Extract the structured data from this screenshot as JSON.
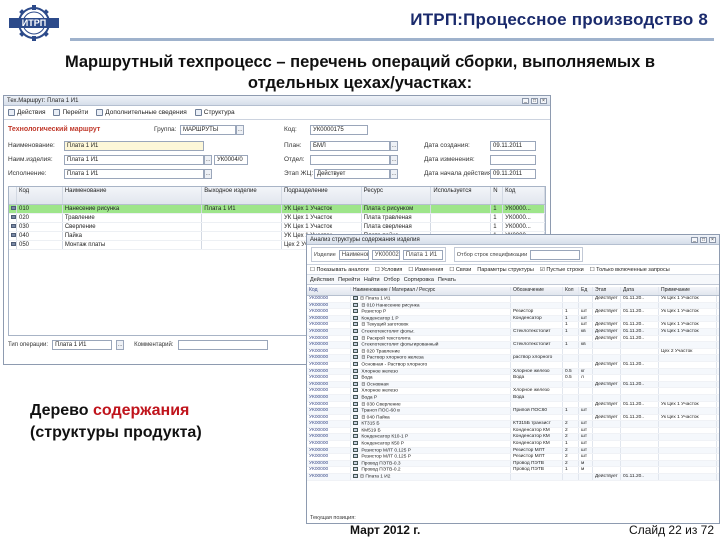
{
  "slide": {
    "title": "ИТРП:Процессное производство 8",
    "subtitle_line1": "Маршрутный техпроцесс – перечень операций сборки, выполняемых в",
    "subtitle_line2": "отдельных цехах/участках:",
    "caption_line1_prefix": "Дерево ",
    "caption_line1_red": "содержания",
    "caption_line2": "(структуры продукта)",
    "footer_date": "Март 2012 г.",
    "footer_slide": "Слайд 22 из 72",
    "logo_text": "ИТРП"
  },
  "window1": {
    "title": "Тех.Маршрут: Плата 1 И1",
    "toolbar": [
      "Действия",
      "Перейти",
      "Дополнительные сведения",
      "Структура"
    ],
    "section": "Технологический маршрут",
    "fields": {
      "group_label": "Группа:",
      "group_value": "МАРШРУТЫ",
      "code_label": "Код:",
      "code_value": "УК0000175",
      "name_label": "Наименование:",
      "name_value": "Плата 1 И1",
      "plan_label": "План:",
      "plan_value": "БМЛ",
      "date_label": "Дата создания:",
      "date_value": "09.11.2011",
      "fullname_label": "Наим.изделия:",
      "fullname_value": "Плата 1 И1",
      "dept_label": "Отдел:",
      "dept_value": "УК0004/0",
      "changed_label": "Дата изменения:",
      "status_label": "Исполнение:",
      "status_value": "Плата 1 И1",
      "state_label": "Этап ЖЦ:",
      "state_value": "Действует",
      "start_label": "Дата начала действия:",
      "start_value": "09.11.2011"
    },
    "grid_headers": [
      "",
      "Код",
      "Наименование",
      "Выходное изделие",
      "Подразделение",
      "Ресурс",
      "Используется",
      "N",
      "Код"
    ],
    "rows": [
      {
        "code": "010",
        "name": "Нанесение рисунка",
        "out": "Плата 1 И1",
        "div": "УК Цех 1 Участок",
        "res": "Плата с рисунком",
        "use": "",
        "n": "1",
        "code2": "УК0000...",
        "sel": true
      },
      {
        "code": "020",
        "name": "Травление",
        "out": "",
        "div": "УК Цех 1 Участок",
        "res": "Плата травленая",
        "use": "",
        "n": "1",
        "code2": "УК0000...",
        "sel": false
      },
      {
        "code": "030",
        "name": "Сверление",
        "out": "",
        "div": "УК Цех 1 Участок",
        "res": "Плата сверленая",
        "use": "",
        "n": "1",
        "code2": "УК0000...",
        "sel": false
      },
      {
        "code": "040",
        "name": "Пайка",
        "out": "",
        "div": "УК Цех 1 Участок",
        "res": "Плата пайка",
        "use": "",
        "n": "1",
        "code2": "УК0000...",
        "sel": false
      },
      {
        "code": "050",
        "name": "Монтаж платы",
        "out": "",
        "div": "Цех 2 Участок",
        "res": "Плата собранная",
        "use": "",
        "n": "1",
        "code2": "УК0000...",
        "sel": false
      }
    ],
    "footer_label": "Тип операции:",
    "footer_value": "Плата 1 И1",
    "comment_label": "Комментарий:"
  },
  "window2": {
    "title": "Анализ структуры содержания изделия",
    "group1": "Изделие",
    "group1_values": [
      "Наименование",
      "УК00002",
      "Плата 1 И1"
    ],
    "group2": "Отбор строк спецификации",
    "toolbar": [
      "Показывать аналоги",
      "Условия",
      "Изменения",
      "Связи",
      "Параметры структуры",
      "Пустые строки",
      "Только включенные запросы"
    ],
    "toolbar2": [
      "Действия",
      "Перейти",
      "Найти",
      "Отбор",
      "Сортировка",
      "Печать"
    ],
    "headers": [
      "Код",
      "Наименование / Материал / Ресурс",
      "Обозначение",
      "Кол",
      "Ед",
      "Этап",
      "Дата",
      "Примечание"
    ],
    "rows": [
      {
        "code": "УК00000",
        "tree": "⊟ Плата 1 И1",
        "type": "",
        "q": "",
        "u": "",
        "st": "Действует",
        "date": "01.11.20..",
        "x": "Ук Цех 1 Участок"
      },
      {
        "code": "УК00000",
        "tree": "  ⊟ 010 Нанесение рисунка",
        "type": "",
        "q": "",
        "u": "",
        "st": "",
        "date": "",
        "x": ""
      },
      {
        "code": "УК00000",
        "tree": "      Резистор Р",
        "type": "Резистор",
        "q": "1",
        "u": "шт",
        "st": "Действует",
        "date": "01.11.20..",
        "x": "Ук Цех 1 Участок"
      },
      {
        "code": "УК00000",
        "tree": "      Конденсатор 1 Р",
        "type": "Конденсатор",
        "q": "1",
        "u": "шт",
        "st": "",
        "date": "",
        "x": ""
      },
      {
        "code": "УК00000",
        "tree": "    ⊟ Текущий заготовок",
        "type": "",
        "q": "1",
        "u": "шт",
        "st": "Действует",
        "date": "01.11.20..",
        "x": "Ук Цех 1 Участок"
      },
      {
        "code": "УК00000",
        "tree": "      Стеклотекстолит фольг.",
        "type": "Стеклотекстолит",
        "q": "1",
        "u": "кв",
        "st": "Действует",
        "date": "01.11.20..",
        "x": "Ук Цех 1 Участок"
      },
      {
        "code": "УК00000",
        "tree": "    ⊟ Раскрой текстолита",
        "type": "",
        "q": "",
        "u": "",
        "st": "Действует",
        "date": "01.11.20..",
        "x": ""
      },
      {
        "code": "УК00000",
        "tree": "      Стеклотекстолит фольгированный",
        "type": "Стеклотекстолит",
        "q": "1",
        "u": "кв",
        "st": "",
        "date": "",
        "x": ""
      },
      {
        "code": "УК00000",
        "tree": "  ⊟ 020 Травление",
        "type": "",
        "q": "",
        "u": "",
        "st": "",
        "date": "",
        "x": "Цех 2 Участок"
      },
      {
        "code": "УК00000",
        "tree": "    ⊟ Раствор хлорного железа",
        "type": "раствор хлорного",
        "q": "",
        "u": "",
        "st": "",
        "date": "",
        "x": ""
      },
      {
        "code": "УК00000",
        "tree": "      Основная - Раствор хлорного",
        "type": "",
        "q": "",
        "u": "",
        "st": "Действует",
        "date": "01.11.20..",
        "x": ""
      },
      {
        "code": "УК00000",
        "tree": "      Хлорное железо",
        "type": "Хлорное железо",
        "q": "0.5",
        "u": "кг",
        "st": "",
        "date": "",
        "x": ""
      },
      {
        "code": "УК00000",
        "tree": "      Вода",
        "type": "Вода",
        "q": "0.5",
        "u": "л",
        "st": "",
        "date": "",
        "x": ""
      },
      {
        "code": "УК00000",
        "tree": "    ⊟ Основная",
        "type": "",
        "q": "",
        "u": "",
        "st": "Действует",
        "date": "01.11.20..",
        "x": ""
      },
      {
        "code": "УК00000",
        "tree": "      Хлорное железо",
        "type": "Хлорное железо",
        "q": "",
        "u": "",
        "st": "",
        "date": "",
        "x": ""
      },
      {
        "code": "УК00000",
        "tree": "      Вода Р",
        "type": "Вода",
        "q": "",
        "u": "",
        "st": "",
        "date": "",
        "x": ""
      },
      {
        "code": "УК00000",
        "tree": "  ⊟ 030 Сверление",
        "type": "",
        "q": "",
        "u": "",
        "st": "Действует",
        "date": "01.11.20..",
        "x": "Ук Цех 1 Участок"
      },
      {
        "code": "УК00000",
        "tree": "    Трансп ПОС-60 в",
        "type": "Припой ПОС60",
        "q": "1",
        "u": "шт",
        "st": "",
        "date": "",
        "x": ""
      },
      {
        "code": "УК00000",
        "tree": "  ⊟ 040 Пайка",
        "type": "",
        "q": "",
        "u": "",
        "st": "Действует",
        "date": "01.11.20..",
        "x": "Ук Цех 1 Участок"
      },
      {
        "code": "УК00000",
        "tree": "      КТ315 Б",
        "type": "КТ315Б транзист",
        "q": "2",
        "u": "шт",
        "st": "",
        "date": "",
        "x": ""
      },
      {
        "code": "УК00000",
        "tree": "      КМ519 Б",
        "type": "Конденсатор КМ",
        "q": "2",
        "u": "шт",
        "st": "",
        "date": "",
        "x": ""
      },
      {
        "code": "УК00000",
        "tree": "      Конденсатор К10-1 Р",
        "type": "Конденсатор КМ",
        "q": "2",
        "u": "шт",
        "st": "",
        "date": "",
        "x": ""
      },
      {
        "code": "УК00000",
        "tree": "      Конденсатор К50 Р",
        "type": "Конденсатор КМ",
        "q": "1",
        "u": "шт",
        "st": "",
        "date": "",
        "x": ""
      },
      {
        "code": "УК00000",
        "tree": "      Резистор МЛТ 0.125 Р",
        "type": "Резистор МЛТ",
        "q": "2",
        "u": "шт",
        "st": "",
        "date": "",
        "x": ""
      },
      {
        "code": "УК00000",
        "tree": "      Резистор МЛТ 0.125 Р",
        "type": "Резистор МЛТ",
        "q": "2",
        "u": "шт",
        "st": "",
        "date": "",
        "x": ""
      },
      {
        "code": "УК00000",
        "tree": "      Провод ПЭТВ-0.3",
        "type": "Провод ПЭТВ",
        "q": "2",
        "u": "м",
        "st": "",
        "date": "",
        "x": ""
      },
      {
        "code": "УК00000",
        "tree": "      Провод ПЭТВ-0.2",
        "type": "Провод ПЭТВ",
        "q": "1",
        "u": "м",
        "st": "",
        "date": "",
        "x": ""
      },
      {
        "code": "УК00000",
        "tree": "⊟ Плата 1 И2",
        "type": "",
        "q": "",
        "u": "",
        "st": "Действует",
        "date": "01.11.20..",
        "x": ""
      }
    ],
    "status": "Текущая позиция:"
  }
}
